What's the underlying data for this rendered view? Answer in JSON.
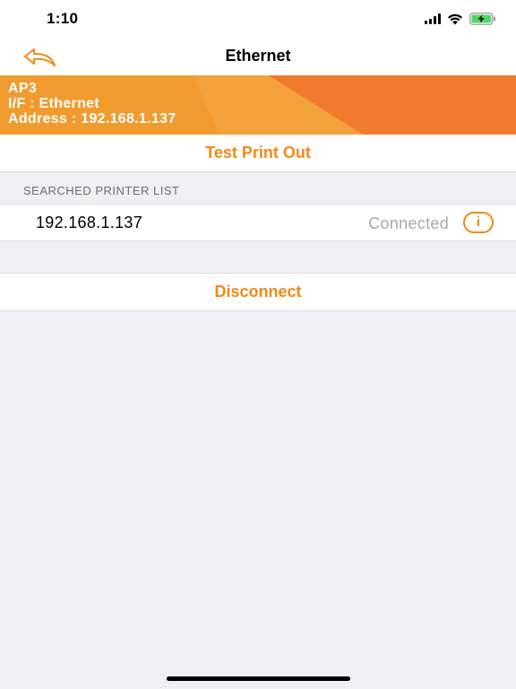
{
  "status_bar": {
    "time": "1:10"
  },
  "nav": {
    "title": "Ethernet",
    "back_icon": "back-arrow-icon"
  },
  "banner": {
    "line1": "AP3",
    "line2": "I/F : Ethernet",
    "line3": "Address : 192.168.1.137",
    "colors": {
      "light": "#f19b2e",
      "mid": "#f3a13a",
      "dark": "#f07a2e"
    }
  },
  "actions": {
    "test_print_label": "Test Print Out",
    "disconnect_label": "Disconnect"
  },
  "printer_list": {
    "header": "SEARCHED PRINTER LIST",
    "items": [
      {
        "address": "192.168.1.137",
        "status": "Connected",
        "info_label": "i"
      }
    ]
  },
  "theme": {
    "accent": "#f08a14",
    "background": "#efeff4",
    "secondary_text": "#a8a8ad"
  }
}
